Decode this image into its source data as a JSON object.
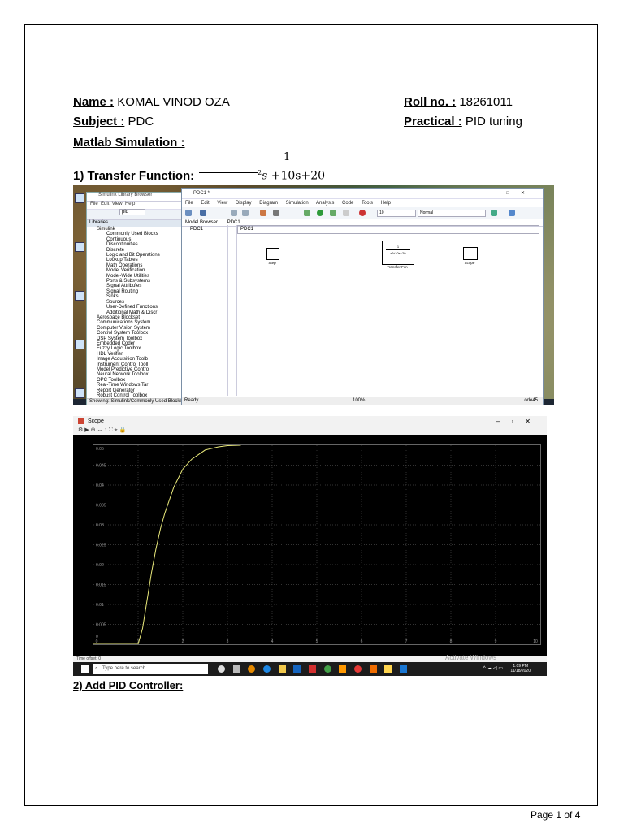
{
  "header": {
    "name_label": "Name :",
    "name_value": " KOMAL VINOD OZA",
    "roll_label": "Roll no. :",
    "roll_value": " 18261011",
    "subject_label": "Subject :",
    "subject_value": " PDC",
    "practical_label": "Practical :",
    "practical_value": " PID tuning",
    "matlab_heading": "Matlab Simulation :"
  },
  "section1": {
    "heading": "1) Transfer Function:",
    "numerator": "1",
    "denominator_s2": "s",
    "denominator_exp": "2",
    "denominator_rest": " +10s+20"
  },
  "library_browser": {
    "title": "Simulink Library Browser",
    "menu": [
      "File",
      "Edit",
      "View",
      "Help"
    ],
    "search": "pid",
    "panel_header": "Libraries",
    "tree_top": "Simulink",
    "tree_children": [
      "Commonly Used Blocks",
      "Continuous",
      "Discontinuities",
      "Discrete",
      "Logic and Bit Operations",
      "Lookup Tables",
      "Math Operations",
      "Model Verification",
      "Model-Wide Utilities",
      "Ports & Subsystems",
      "Signal Attributes",
      "Signal Routing",
      "Sinks",
      "Sources",
      "User-Defined Functions",
      "Additional Math & Discr"
    ],
    "toolboxes": [
      "Aerospace Blockset",
      "Communications System",
      "Computer Vision System",
      "Control System Toolbox",
      "DSP System Toolbox",
      "Embedded Coder",
      "Fuzzy Logic Toolbox",
      "HDL Verifier",
      "Image Acquisition Toolb",
      "Instrument Control Tooll",
      "Model Predictive Contro",
      "Neural Network Toolbox",
      "OPC Toolbox",
      "Real-Time Windows Tar",
      "Report Generator",
      "Robust Control Toolbox"
    ],
    "status": "Showing: Simulink/Commonly Used Blocks"
  },
  "model_window": {
    "title": "PDC1 *",
    "menu": [
      "File",
      "Edit",
      "View",
      "Display",
      "Diagram",
      "Simulation",
      "Analysis",
      "Code",
      "Tools",
      "Help"
    ],
    "stop_time": "10",
    "mode": "Normal",
    "tab_browser": "Model Browser",
    "tab_model": "PDC1",
    "tree_item": "PDC1",
    "address": "PDC1",
    "blocks": {
      "step": "Step",
      "tf_num": "1",
      "tf_den": "s²+10s+20",
      "tf_label": "Transfer Fcn",
      "scope": "Scope"
    },
    "status": "Ready",
    "zoom": "100%",
    "solver": "ode45"
  },
  "scope_window": {
    "title": "Scope",
    "time_offset": "Time offset:  0",
    "watermark": "Activate Windows",
    "search_placeholder": "Type here to search",
    "clock_time": "1:09 PM",
    "clock_date": "11/18/2020"
  },
  "chart_data": {
    "type": "line",
    "title": "",
    "xlabel": "",
    "ylabel": "",
    "x_ticks": [
      "0",
      "1",
      "2",
      "3",
      "4",
      "5",
      "6",
      "7",
      "8",
      "9",
      "10"
    ],
    "y_ticks": [
      "0",
      "0.005",
      "0.01",
      "0.015",
      "0.02",
      "0.025",
      "0.03",
      "0.035",
      "0.04",
      "0.045",
      "0.05"
    ],
    "xlim": [
      0,
      10
    ],
    "ylim": [
      0,
      0.05
    ],
    "grid": true,
    "series": [
      {
        "color": "#e8e87a",
        "x": [
          0,
          1.0,
          1.1,
          1.2,
          1.3,
          1.4,
          1.5,
          1.6,
          1.8,
          2.0,
          2.2,
          2.5,
          2.8,
          3.0,
          3.3
        ],
        "y": [
          0,
          0,
          0.004,
          0.011,
          0.018,
          0.024,
          0.029,
          0.033,
          0.0395,
          0.044,
          0.0465,
          0.0488,
          0.0496,
          0.0499,
          0.05
        ]
      }
    ]
  },
  "section2": {
    "heading": "2) Add PID Controller:"
  },
  "footer": {
    "page": "Page 1 of 4"
  }
}
